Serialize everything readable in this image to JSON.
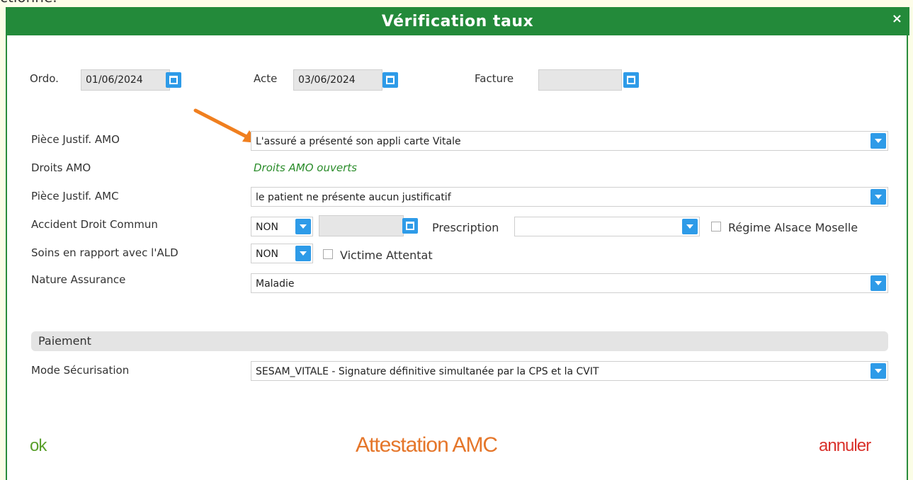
{
  "background_text": "ctionne.",
  "dialog": {
    "title": "Vérification taux",
    "close_glyph": "×"
  },
  "dates": {
    "ordo_label": "Ordo.",
    "ordo_value": "01/06/2024",
    "acte_label": "Acte",
    "acte_value": "03/06/2024",
    "facture_label": "Facture",
    "facture_value": ""
  },
  "fields": {
    "piece_amo_label": "Pièce Justif. AMO",
    "piece_amo_value": "L'assuré a présenté son appli carte Vitale",
    "droits_amo_label": "Droits AMO",
    "droits_amo_value": "Droits AMO ouverts",
    "piece_amc_label": "Pièce Justif. AMC",
    "piece_amc_value": "le patient ne présente aucun justificatif",
    "accident_label": "Accident Droit Commun",
    "accident_value": "NON",
    "accident_date_value": "",
    "prescription_label": "Prescription",
    "prescription_value": "",
    "regime_label": "Régime Alsace Moselle",
    "soins_label": "Soins en rapport avec l'ALD",
    "soins_value": "NON",
    "victime_label": "Victime Attentat",
    "nature_label": "Nature Assurance",
    "nature_value": "Maladie"
  },
  "paiement": {
    "section_title": "Paiement",
    "mode_label": "Mode Sécurisation",
    "mode_value": "SESAM_VITALE - Signature définitive simultanée par la CPS et la CVIT"
  },
  "footer": {
    "ok": "ok",
    "attestation": "Attestation AMC",
    "annuler": "annuler"
  },
  "colors": {
    "titlebar": "#238a3a",
    "accent_blue": "#2e9be8",
    "droits_green": "#2a8c2a",
    "ok_green": "#5aa02c",
    "attestation_orange": "#e5762a",
    "annuler_red": "#d9312b",
    "arrow_orange": "#f07f1f"
  },
  "icons": [
    "close-icon",
    "calendar-icon",
    "dropdown-arrow-icon",
    "checkbox-icon",
    "annotation-arrow-icon"
  ]
}
